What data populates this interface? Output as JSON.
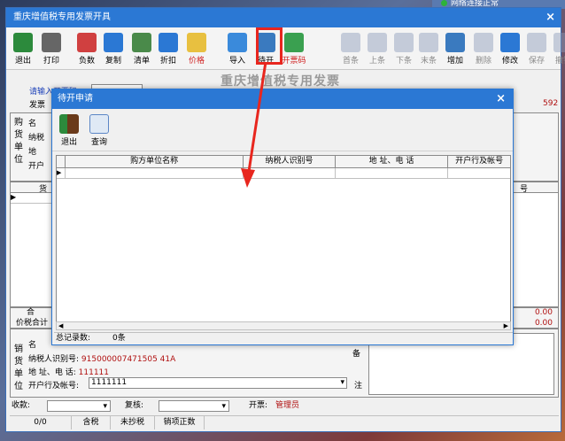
{
  "net_status": "网络连接正常",
  "main_window": {
    "title": "重庆增值税专用发票开具",
    "close": "×",
    "toolbar": [
      {
        "label": "退出",
        "icon": "exit-door-icon"
      },
      {
        "label": "打印",
        "icon": "printer-icon"
      },
      {
        "label": "负数",
        "icon": "negative-invoice-icon"
      },
      {
        "label": "复制",
        "icon": "copy-icon"
      },
      {
        "label": "清单",
        "icon": "list-icon"
      },
      {
        "label": "折扣",
        "icon": "discount-icon"
      },
      {
        "label": "价格",
        "icon": "price-icon"
      },
      {
        "label": "导入",
        "icon": "import-icon"
      },
      {
        "label": "待开",
        "icon": "pending-icon"
      },
      {
        "label": "开票码",
        "icon": "invoice-code-icon"
      },
      {
        "label": "首条",
        "icon": "first-icon"
      },
      {
        "label": "上条",
        "icon": "prev-icon"
      },
      {
        "label": "下条",
        "icon": "next-icon"
      },
      {
        "label": "末条",
        "icon": "last-icon"
      },
      {
        "label": "增加",
        "icon": "add-icon"
      },
      {
        "label": "删除",
        "icon": "delete-icon"
      },
      {
        "label": "修改",
        "icon": "edit-icon"
      },
      {
        "label": "保存",
        "icon": "save-icon"
      },
      {
        "label": "撤销",
        "icon": "undo-icon"
      }
    ],
    "form_title": "重庆增值税专用发票",
    "prompt_label": "请输入开票码",
    "invoice_label": "发票",
    "invoice_no_fragment": "592",
    "buyer_vertical": "购货单位",
    "buyer_fields": [
      "名",
      "纳税",
      "地",
      "开户"
    ],
    "left_col_header": "货",
    "right_col_header": "号",
    "total_label": "合",
    "tax_total_label": "价税合计",
    "amount_1": "0.00",
    "amount_2": "0.00",
    "seller_vertical": "销货单位",
    "seller_name_label": "名",
    "seller_taxid_label": "纳税人识别号:",
    "seller_taxid": "915000007471505 41A",
    "seller_addr_label": "地 址、电 话:",
    "seller_addr": "111111",
    "seller_bank_label": "开户行及帐号:",
    "seller_bank": "1111111",
    "remark_label": "注",
    "remark_label_2": "备",
    "payee_label": "收款:",
    "reviewer_label": "复核:",
    "drawer_label": "开票:",
    "drawer_value": "管理员",
    "footer": [
      "0/0",
      "含税",
      "未抄税",
      "销项正数"
    ]
  },
  "popup": {
    "title": "待开申请",
    "close": "×",
    "toolbar": [
      {
        "label": "退出",
        "icon": "exit-door-icon"
      },
      {
        "label": "查询",
        "icon": "query-icon"
      }
    ],
    "columns": [
      "购方单位名称",
      "纳税人识别号",
      "地 址、电 话",
      "开户行及帐号"
    ],
    "rows": [],
    "total_label": "总记录数:",
    "total_value": "0条"
  }
}
